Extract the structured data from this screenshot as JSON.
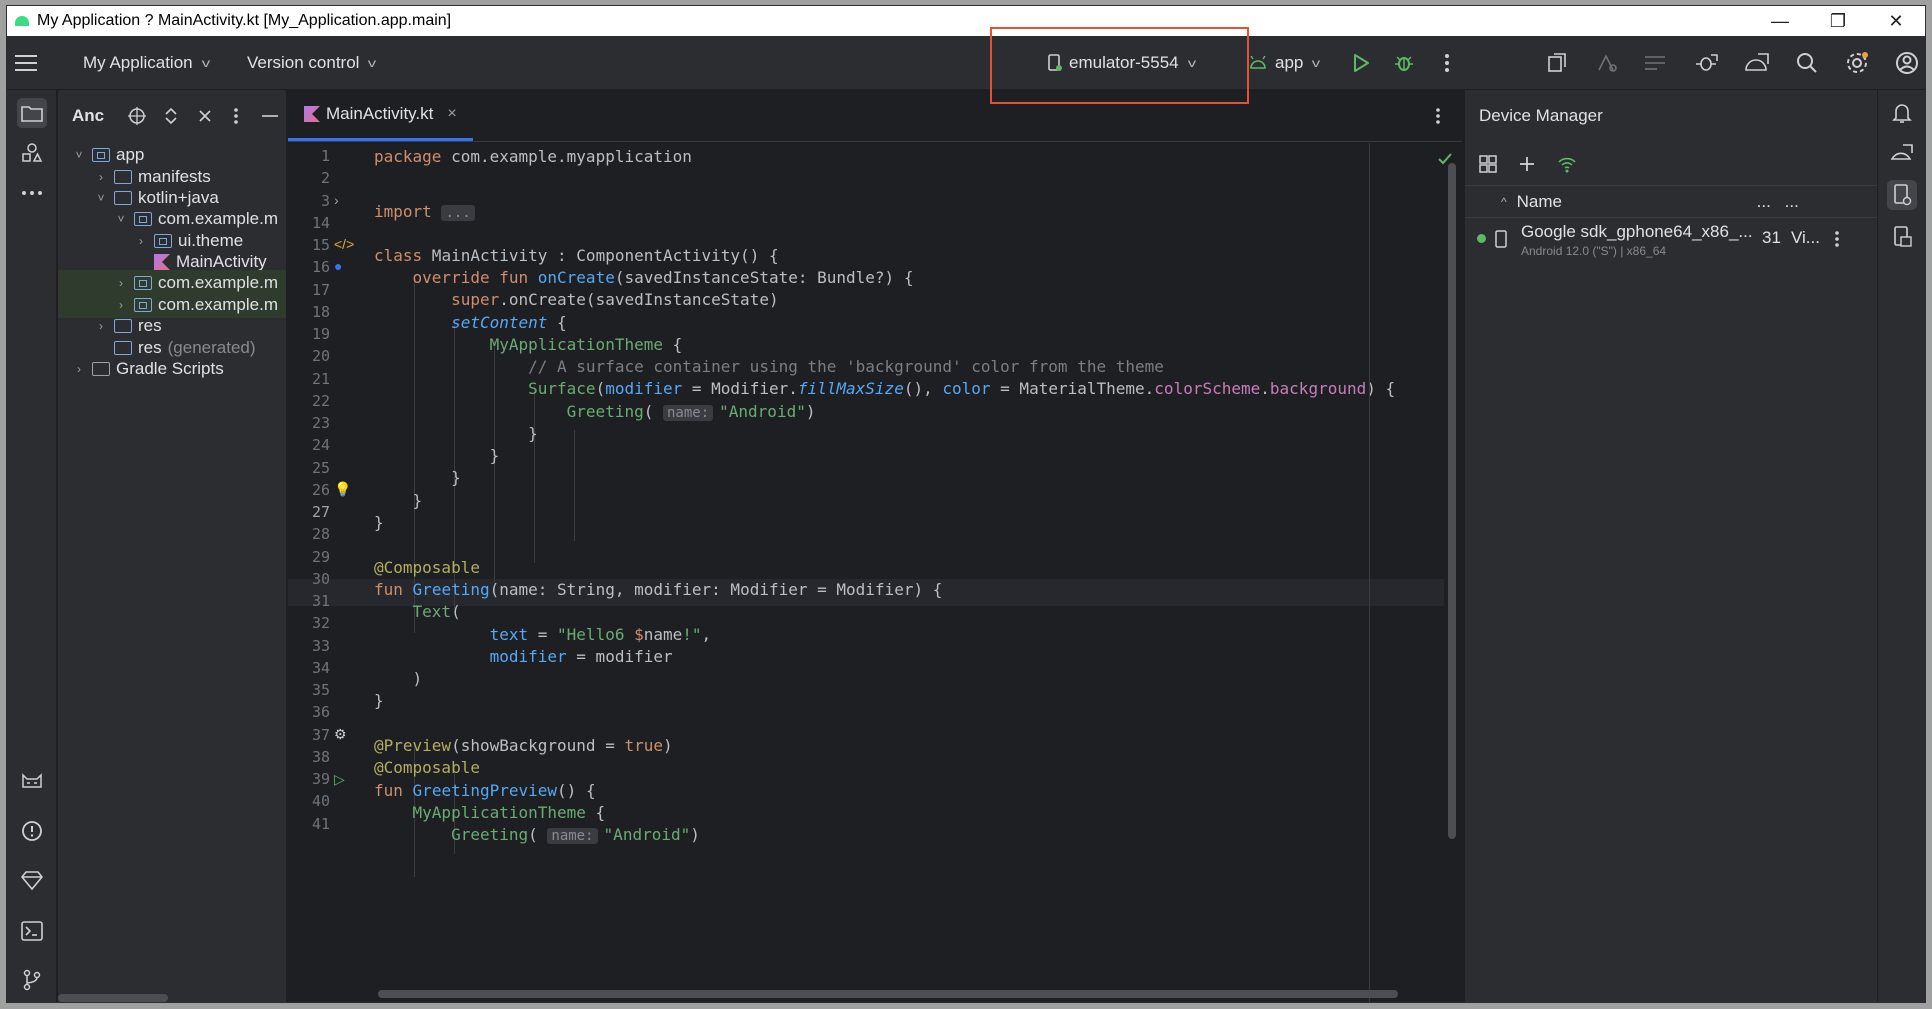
{
  "window": {
    "title": "My Application ? MainActivity.kt [My_Application.app.main]",
    "minimize": "—",
    "restore": "❐",
    "close": "✕"
  },
  "toolbar": {
    "project_name": "My Application",
    "version_control": "Version control",
    "device": "emulator-5554",
    "run_config": "app"
  },
  "project_panel": {
    "title": "Anc",
    "tree": [
      {
        "label": "app",
        "arrow": "˅",
        "icon": "module"
      },
      {
        "label": "manifests",
        "arrow": "›",
        "icon": "folder"
      },
      {
        "label": "kotlin+java",
        "arrow": "˅",
        "icon": "folder"
      },
      {
        "label": "com.example.m",
        "arrow": "˅",
        "icon": "package"
      },
      {
        "label": "ui.theme",
        "arrow": "›",
        "icon": "package"
      },
      {
        "label": "MainActivity",
        "arrow": "",
        "icon": "kotlin"
      },
      {
        "label": "com.example.m",
        "arrow": "›",
        "icon": "package"
      },
      {
        "label": "com.example.m",
        "arrow": "›",
        "icon": "package"
      },
      {
        "label": "res",
        "arrow": "›",
        "icon": "folder"
      },
      {
        "label": "res",
        "suffix": "(generated)",
        "arrow": "",
        "icon": "folder"
      },
      {
        "label": "Gradle Scripts",
        "arrow": "›",
        "icon": "gradle"
      }
    ]
  },
  "editor": {
    "tab_label": "MainActivity.kt",
    "tab_close": "×",
    "line_numbers": [
      "1",
      "2",
      "3",
      "14",
      "15",
      "16",
      "17",
      "18",
      "19",
      "20",
      "21",
      "22",
      "23",
      "24",
      "25",
      "26",
      "27",
      "28",
      "29",
      "30",
      "31",
      "32",
      "33",
      "34",
      "35",
      "36",
      "37",
      "38",
      "39",
      "40",
      "41"
    ],
    "current_line": "27"
  },
  "device_manager": {
    "title": "Device Manager",
    "column_name": "Name",
    "column_more1": "...",
    "column_more2": "...",
    "device_name": "Google sdk_gphone64_x86_...",
    "device_sub": "Android 12.0 (\"S\") | x86_64",
    "device_api": "31",
    "device_type": "Vi..."
  },
  "colors": {
    "accent": "#3574f0",
    "run_green": "#5fb865",
    "highlight_box": "#e0533a",
    "keyword": "#cf8e6d",
    "string": "#6aab73"
  }
}
